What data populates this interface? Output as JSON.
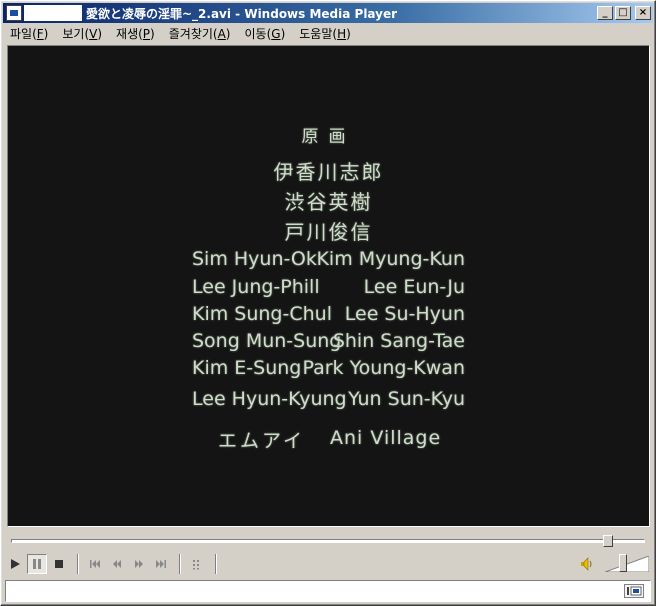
{
  "window": {
    "title": "愛欲と凌辱の淫罪~_2.avi - Windows Media Player",
    "minimize_glyph": "_",
    "maximize_glyph": "□",
    "close_glyph": "×"
  },
  "menu": [
    {
      "label": "파일(",
      "accel": "F",
      "tail": ")"
    },
    {
      "label": "보기(",
      "accel": "V",
      "tail": ")"
    },
    {
      "label": "재생(",
      "accel": "P",
      "tail": ")"
    },
    {
      "label": "즐겨찾기(",
      "accel": "A",
      "tail": ")"
    },
    {
      "label": "이동(",
      "accel": "G",
      "tail": ")"
    },
    {
      "label": "도움말(",
      "accel": "H",
      "tail": ")"
    }
  ],
  "video": {
    "heading": "原画",
    "jp_names": [
      "伊香川志郎",
      "渋谷英樹",
      "戸川俊信"
    ],
    "name_rows": [
      {
        "left": "Sim Hyun-Ok",
        "right": "Kim Myung-Kun"
      },
      {
        "left": "Lee Jung-Phill",
        "right": "Lee Eun-Ju"
      },
      {
        "left": "Kim Sung-Chul",
        "right": "Lee Su-Hyun"
      },
      {
        "left": "Song Mun-Sung",
        "right": "Shin Sang-Tae"
      },
      {
        "left": "Kim E-Sung",
        "right": "Park Young-Kwan"
      },
      {
        "left": "Lee Hyun-Kyung",
        "right": "Yun Sun-Kyu"
      }
    ],
    "studio": {
      "left": "エムアイ",
      "right": "Ani Village"
    }
  },
  "playback": {
    "seek_position": 0.95,
    "volume_level": 0.4
  },
  "icons": {
    "play": "play-icon",
    "pause": "pause-icon",
    "stop": "stop-icon",
    "skip_back": "skip-back-icon",
    "rewind": "rewind-icon",
    "fast_forward": "fast-forward-icon",
    "skip_forward": "skip-forward-icon",
    "playlist": "playlist-icon",
    "speaker": "speaker-icon",
    "status": "media-status-icon"
  },
  "colors": {
    "title_start": "#0a246a",
    "title_end": "#a6caf0",
    "video_bg": "#141414",
    "credit_text": "#cfdccb",
    "chrome": "#d4d0c8"
  }
}
